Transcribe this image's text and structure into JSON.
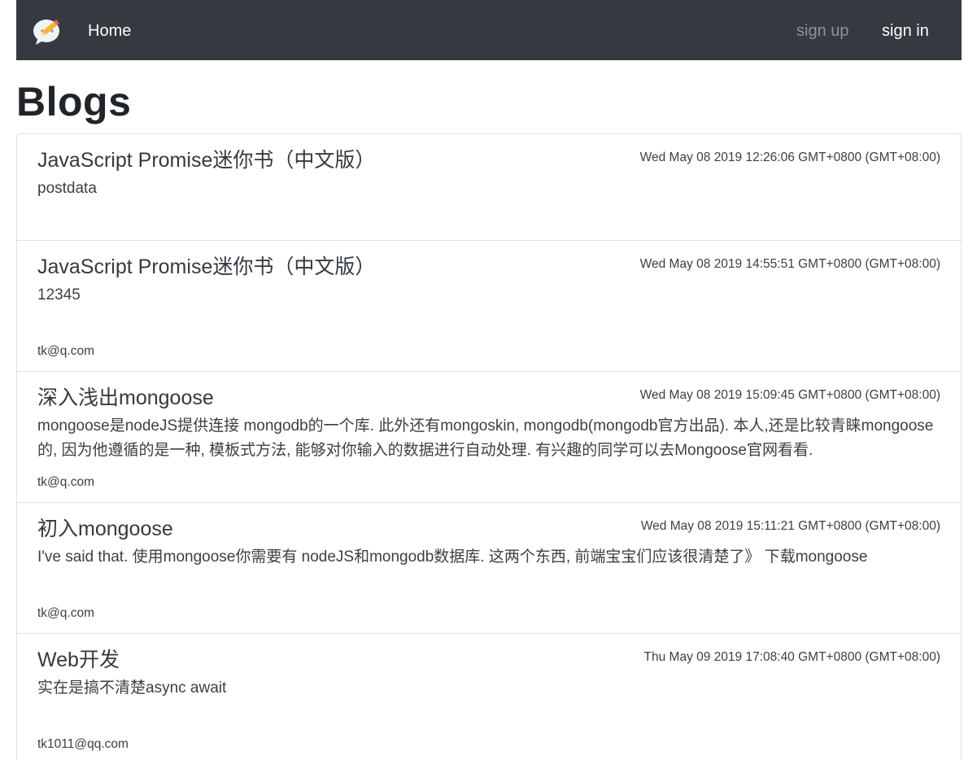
{
  "navbar": {
    "brand_icon": "chat-bubble-pencil-logo",
    "home_label": "Home",
    "signup_label": "sign up",
    "signin_label": "sign in",
    "background": "#343a40"
  },
  "page": {
    "title": "Blogs"
  },
  "posts": [
    {
      "title": "JavaScript Promise迷你书（中文版）",
      "date": "Wed May 08 2019 12:26:06 GMT+0800 (GMT+08:00)",
      "body": "postdata",
      "author": ""
    },
    {
      "title": "JavaScript Promise迷你书（中文版）",
      "date": "Wed May 08 2019 14:55:51 GMT+0800 (GMT+08:00)",
      "body": "12345",
      "author": "tk@q.com"
    },
    {
      "title": "深入浅出mongoose",
      "date": "Wed May 08 2019 15:09:45 GMT+0800 (GMT+08:00)",
      "body": "mongoose是nodeJS提供连接 mongodb的一个库. 此外还有mongoskin, mongodb(mongodb官方出品). 本人,还是比较青睐mongoose的, 因为他遵循的是一种, 模板式方法, 能够对你输入的数据进行自动处理. 有兴趣的同学可以去Mongoose官网看看.",
      "author": "tk@q.com"
    },
    {
      "title": "初入mongoose",
      "date": "Wed May 08 2019 15:11:21 GMT+0800 (GMT+08:00)",
      "body": "I've said that. 使用mongoose你需要有 nodeJS和mongodb数据库. 这两个东西, 前端宝宝们应该很清楚了》 下载mongoose",
      "author": "tk@q.com"
    },
    {
      "title": "Web开发",
      "date": "Thu May 09 2019 17:08:40 GMT+0800 (GMT+08:00)",
      "body": "实在是搞不清楚async await",
      "author": "tk1011@qq.com"
    }
  ]
}
